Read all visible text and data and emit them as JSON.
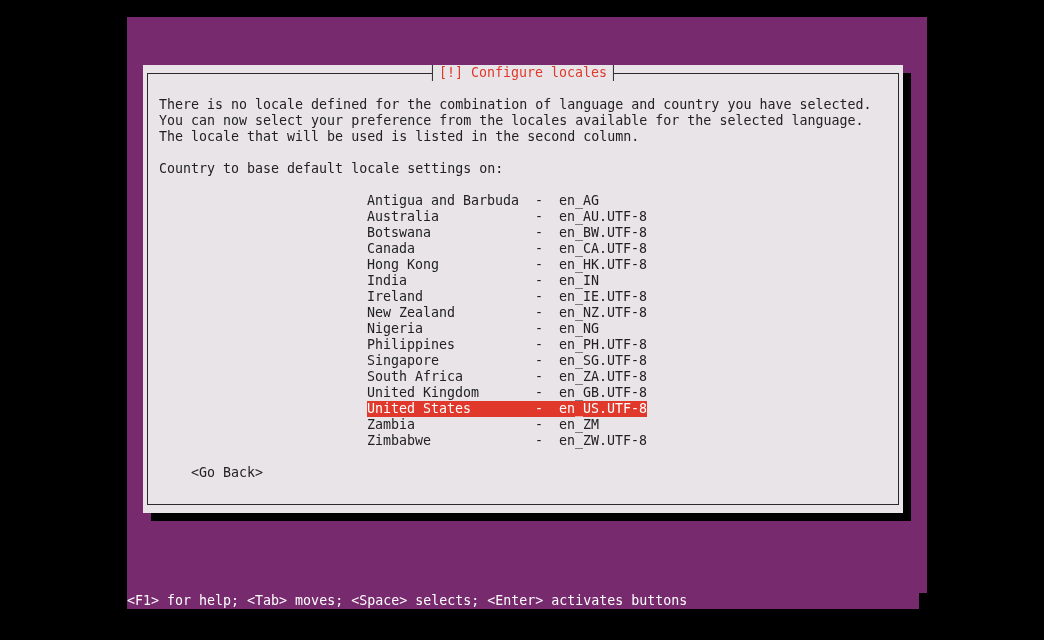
{
  "dialog": {
    "title": "[!] Configure locales",
    "message": [
      "There is no locale defined for the combination of language and country you have selected.",
      "You can now select your preference from the locales available for the selected language.",
      "The locale that will be used is listed in the second column."
    ],
    "prompt": "Country to base default locale settings on:",
    "items": [
      {
        "country": "Antigua and Barbuda",
        "dash": "-",
        "locale": "en_AG",
        "selected": false
      },
      {
        "country": "Australia",
        "dash": "-",
        "locale": "en_AU.UTF-8",
        "selected": false
      },
      {
        "country": "Botswana",
        "dash": "-",
        "locale": "en_BW.UTF-8",
        "selected": false
      },
      {
        "country": "Canada",
        "dash": "-",
        "locale": "en_CA.UTF-8",
        "selected": false
      },
      {
        "country": "Hong Kong",
        "dash": "-",
        "locale": "en_HK.UTF-8",
        "selected": false
      },
      {
        "country": "India",
        "dash": "-",
        "locale": "en_IN",
        "selected": false
      },
      {
        "country": "Ireland",
        "dash": "-",
        "locale": "en_IE.UTF-8",
        "selected": false
      },
      {
        "country": "New Zealand",
        "dash": "-",
        "locale": "en_NZ.UTF-8",
        "selected": false
      },
      {
        "country": "Nigeria",
        "dash": "-",
        "locale": "en_NG",
        "selected": false
      },
      {
        "country": "Philippines",
        "dash": "-",
        "locale": "en_PH.UTF-8",
        "selected": false
      },
      {
        "country": "Singapore",
        "dash": "-",
        "locale": "en_SG.UTF-8",
        "selected": false
      },
      {
        "country": "South Africa",
        "dash": "-",
        "locale": "en_ZA.UTF-8",
        "selected": false
      },
      {
        "country": "United Kingdom",
        "dash": "-",
        "locale": "en_GB.UTF-8",
        "selected": false
      },
      {
        "country": "United States",
        "dash": "-",
        "locale": "en_US.UTF-8",
        "selected": true
      },
      {
        "country": "Zambia",
        "dash": "-",
        "locale": "en_ZM",
        "selected": false
      },
      {
        "country": "Zimbabwe",
        "dash": "-",
        "locale": "en_ZW.UTF-8",
        "selected": false
      }
    ],
    "buttons": [
      "<Go Back>"
    ]
  },
  "status_bar": "<F1> for help; <Tab> moves; <Space> selects; <Enter> activates buttons"
}
